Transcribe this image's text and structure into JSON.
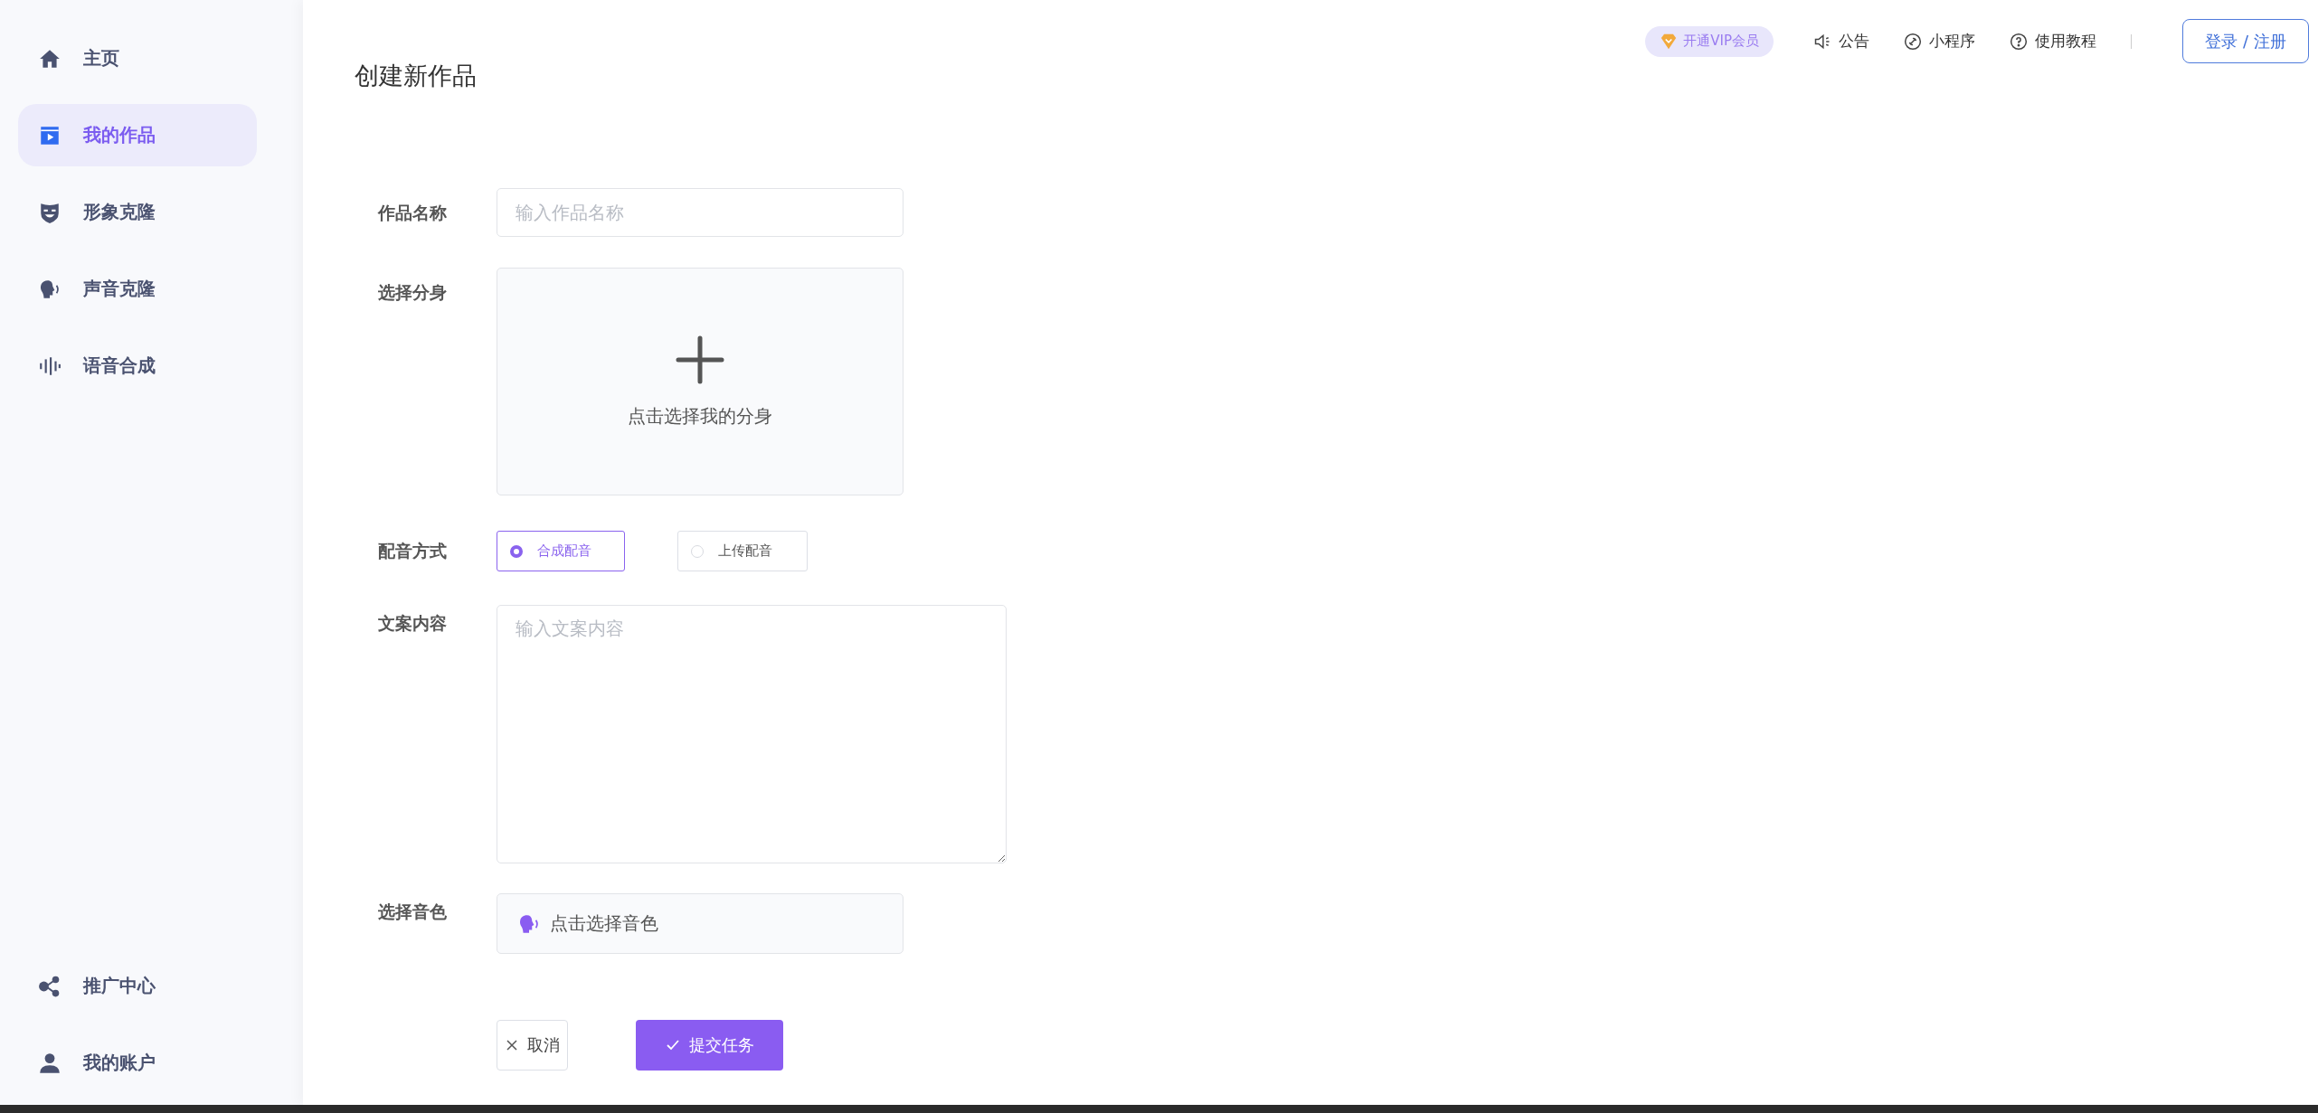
{
  "sidebar": {
    "items": [
      {
        "label": "主页",
        "kind": "home",
        "selected": false
      },
      {
        "label": "我的作品",
        "kind": "video",
        "selected": true
      },
      {
        "label": "形象克隆",
        "kind": "mask",
        "selected": false
      },
      {
        "label": "声音克隆",
        "kind": "voice",
        "selected": false
      },
      {
        "label": "语音合成",
        "kind": "wave",
        "selected": false
      }
    ],
    "bottom_items": [
      {
        "label": "推广中心",
        "kind": "share",
        "selected": false
      },
      {
        "label": "我的账户",
        "kind": "user",
        "selected": false
      }
    ]
  },
  "header": {
    "vip_badge": "开通VIP会员",
    "links": [
      {
        "label": "公告",
        "kind": "speaker"
      },
      {
        "label": "小程序",
        "kind": "link"
      },
      {
        "label": "使用教程",
        "kind": "help"
      }
    ],
    "login_button": "登录 / 注册"
  },
  "page_title": "创建新作品",
  "form": {
    "name": {
      "label": "作品名称",
      "placeholder": "输入作品名称"
    },
    "avatar": {
      "label": "选择分身",
      "hint": "点击选择我的分身"
    },
    "dubbing": {
      "label": "配音方式",
      "options": [
        {
          "label": "合成配音",
          "selected": true
        },
        {
          "label": "上传配音",
          "selected": false
        }
      ]
    },
    "script": {
      "label": "文案内容",
      "placeholder": "输入文案内容"
    },
    "voice": {
      "label": "选择音色",
      "hint": "点击选择音色"
    }
  },
  "buttons": [
    {
      "label": "取消",
      "kind": "cancel"
    },
    {
      "label": "提交任务",
      "kind": "submit"
    }
  ]
}
